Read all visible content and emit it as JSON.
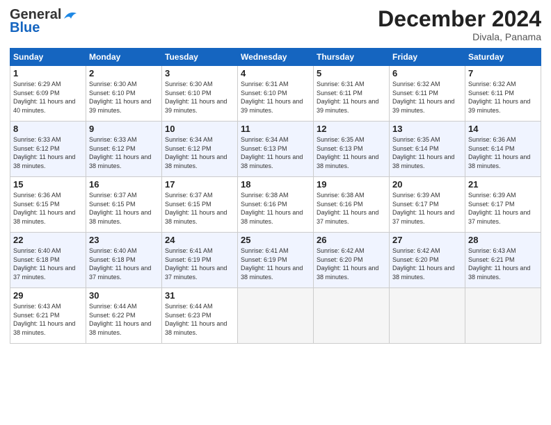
{
  "header": {
    "logo_line1": "General",
    "logo_line2": "Blue",
    "month": "December 2024",
    "location": "Divala, Panama"
  },
  "days_of_week": [
    "Sunday",
    "Monday",
    "Tuesday",
    "Wednesday",
    "Thursday",
    "Friday",
    "Saturday"
  ],
  "weeks": [
    [
      {
        "num": "1",
        "rise": "6:29 AM",
        "set": "6:09 PM",
        "daylight": "11 hours and 40 minutes."
      },
      {
        "num": "2",
        "rise": "6:30 AM",
        "set": "6:10 PM",
        "daylight": "11 hours and 39 minutes."
      },
      {
        "num": "3",
        "rise": "6:30 AM",
        "set": "6:10 PM",
        "daylight": "11 hours and 39 minutes."
      },
      {
        "num": "4",
        "rise": "6:31 AM",
        "set": "6:10 PM",
        "daylight": "11 hours and 39 minutes."
      },
      {
        "num": "5",
        "rise": "6:31 AM",
        "set": "6:11 PM",
        "daylight": "11 hours and 39 minutes."
      },
      {
        "num": "6",
        "rise": "6:32 AM",
        "set": "6:11 PM",
        "daylight": "11 hours and 39 minutes."
      },
      {
        "num": "7",
        "rise": "6:32 AM",
        "set": "6:11 PM",
        "daylight": "11 hours and 39 minutes."
      }
    ],
    [
      {
        "num": "8",
        "rise": "6:33 AM",
        "set": "6:12 PM",
        "daylight": "11 hours and 38 minutes."
      },
      {
        "num": "9",
        "rise": "6:33 AM",
        "set": "6:12 PM",
        "daylight": "11 hours and 38 minutes."
      },
      {
        "num": "10",
        "rise": "6:34 AM",
        "set": "6:12 PM",
        "daylight": "11 hours and 38 minutes."
      },
      {
        "num": "11",
        "rise": "6:34 AM",
        "set": "6:13 PM",
        "daylight": "11 hours and 38 minutes."
      },
      {
        "num": "12",
        "rise": "6:35 AM",
        "set": "6:13 PM",
        "daylight": "11 hours and 38 minutes."
      },
      {
        "num": "13",
        "rise": "6:35 AM",
        "set": "6:14 PM",
        "daylight": "11 hours and 38 minutes."
      },
      {
        "num": "14",
        "rise": "6:36 AM",
        "set": "6:14 PM",
        "daylight": "11 hours and 38 minutes."
      }
    ],
    [
      {
        "num": "15",
        "rise": "6:36 AM",
        "set": "6:15 PM",
        "daylight": "11 hours and 38 minutes."
      },
      {
        "num": "16",
        "rise": "6:37 AM",
        "set": "6:15 PM",
        "daylight": "11 hours and 38 minutes."
      },
      {
        "num": "17",
        "rise": "6:37 AM",
        "set": "6:15 PM",
        "daylight": "11 hours and 38 minutes."
      },
      {
        "num": "18",
        "rise": "6:38 AM",
        "set": "6:16 PM",
        "daylight": "11 hours and 38 minutes."
      },
      {
        "num": "19",
        "rise": "6:38 AM",
        "set": "6:16 PM",
        "daylight": "11 hours and 37 minutes."
      },
      {
        "num": "20",
        "rise": "6:39 AM",
        "set": "6:17 PM",
        "daylight": "11 hours and 37 minutes."
      },
      {
        "num": "21",
        "rise": "6:39 AM",
        "set": "6:17 PM",
        "daylight": "11 hours and 37 minutes."
      }
    ],
    [
      {
        "num": "22",
        "rise": "6:40 AM",
        "set": "6:18 PM",
        "daylight": "11 hours and 37 minutes."
      },
      {
        "num": "23",
        "rise": "6:40 AM",
        "set": "6:18 PM",
        "daylight": "11 hours and 37 minutes."
      },
      {
        "num": "24",
        "rise": "6:41 AM",
        "set": "6:19 PM",
        "daylight": "11 hours and 37 minutes."
      },
      {
        "num": "25",
        "rise": "6:41 AM",
        "set": "6:19 PM",
        "daylight": "11 hours and 38 minutes."
      },
      {
        "num": "26",
        "rise": "6:42 AM",
        "set": "6:20 PM",
        "daylight": "11 hours and 38 minutes."
      },
      {
        "num": "27",
        "rise": "6:42 AM",
        "set": "6:20 PM",
        "daylight": "11 hours and 38 minutes."
      },
      {
        "num": "28",
        "rise": "6:43 AM",
        "set": "6:21 PM",
        "daylight": "11 hours and 38 minutes."
      }
    ],
    [
      {
        "num": "29",
        "rise": "6:43 AM",
        "set": "6:21 PM",
        "daylight": "11 hours and 38 minutes."
      },
      {
        "num": "30",
        "rise": "6:44 AM",
        "set": "6:22 PM",
        "daylight": "11 hours and 38 minutes."
      },
      {
        "num": "31",
        "rise": "6:44 AM",
        "set": "6:23 PM",
        "daylight": "11 hours and 38 minutes."
      },
      null,
      null,
      null,
      null
    ]
  ]
}
